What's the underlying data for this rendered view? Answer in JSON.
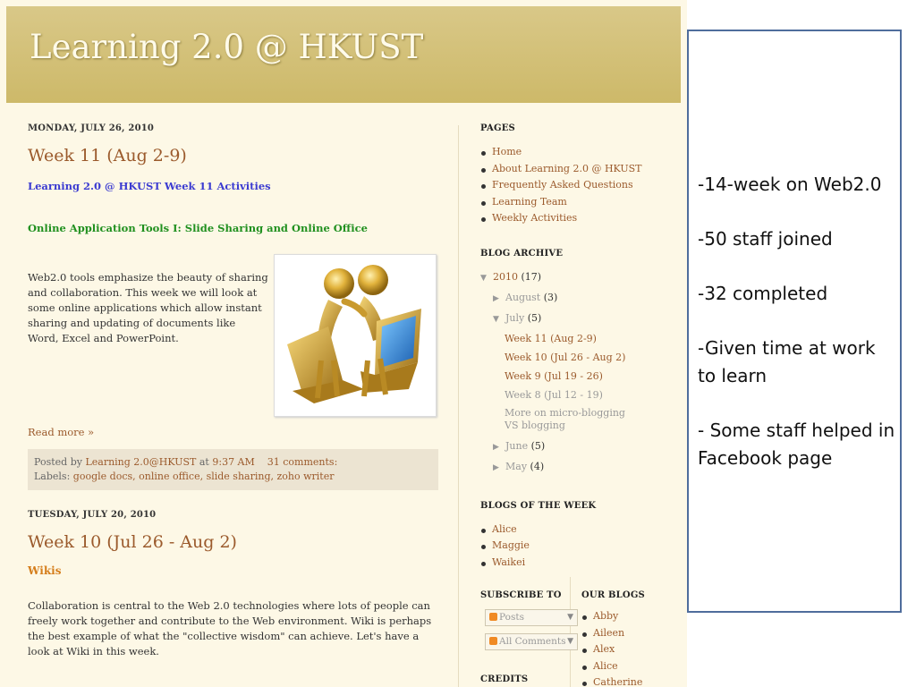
{
  "blog": {
    "title": "Learning 2.0 @ HKUST",
    "posts": [
      {
        "date": "MONDAY, JULY 26, 2010",
        "title": "Week 11 (Aug 2-9)",
        "subtitle_link": "Learning 2.0 @ HKUST Week 11 Activities",
        "section_link": "Online Application Tools I: Slide Sharing and Online Office",
        "body": "Web2.0 tools emphasize the beauty of sharing and collaboration. This week we will look at some online applications which allow instant sharing and updating of documents like Word, Excel and PowerPoint.",
        "read_more": "Read more »",
        "posted_by_label": "Posted by",
        "author": "Learning 2.0@HKUST",
        "at": "at",
        "time": "9:37 AM",
        "comments": "31 comments:",
        "labels_label": "Labels:",
        "labels": "google docs, online office, slide sharing, zoho writer"
      },
      {
        "date": "TUESDAY, JULY 20, 2010",
        "title": "Week 10 (Jul 26 - Aug 2)",
        "section": "Wikis",
        "body": "Collaboration is central to the Web 2.0 technologies where lots of people can freely work together and contribute to the Web environment. Wiki is perhaps the best example of what the \"collective wisdom\" can achieve. Let's have a look at Wiki in this week."
      }
    ]
  },
  "sidebar": {
    "pages_title": "PAGES",
    "pages": [
      "Home",
      "About Learning 2.0 @ HKUST",
      "Frequently Asked Questions",
      "Learning Team",
      "Weekly Activities"
    ],
    "archive_title": "BLOG ARCHIVE",
    "archive": {
      "year": "2010",
      "year_count": "(17)",
      "august": "August",
      "august_count": "(3)",
      "july": "July",
      "july_count": "(5)",
      "july_posts": [
        "Week 11 (Aug 2-9)",
        "Week 10 (Jul 26 - Aug 2)",
        "Week 9 (Jul 19 - 26)"
      ],
      "july_muted": [
        "Week 8 (Jul 12 - 19)",
        "More on micro-blogging VS blogging"
      ],
      "june": "June",
      "june_count": "(5)",
      "may": "May",
      "may_count": "(4)"
    },
    "blogs_week_title": "BLOGS OF THE WEEK",
    "blogs_week": [
      "Alice",
      "Maggie",
      "Waikei"
    ],
    "subscribe_title": "SUBSCRIBE TO",
    "subscribe": [
      "Posts",
      "All Comments"
    ],
    "our_blogs_title": "OUR BLOGS",
    "our_blogs": [
      "Abby",
      "Aileen",
      "Alex",
      "Alice",
      "Catherine"
    ],
    "credits_title": "CREDITS"
  },
  "slide": {
    "bullets": [
      "-14-week on Web2.0",
      "-50 staff joined",
      "-32 completed",
      "-Given time at work to learn",
      "- Some staff helped in Facebook page"
    ]
  }
}
